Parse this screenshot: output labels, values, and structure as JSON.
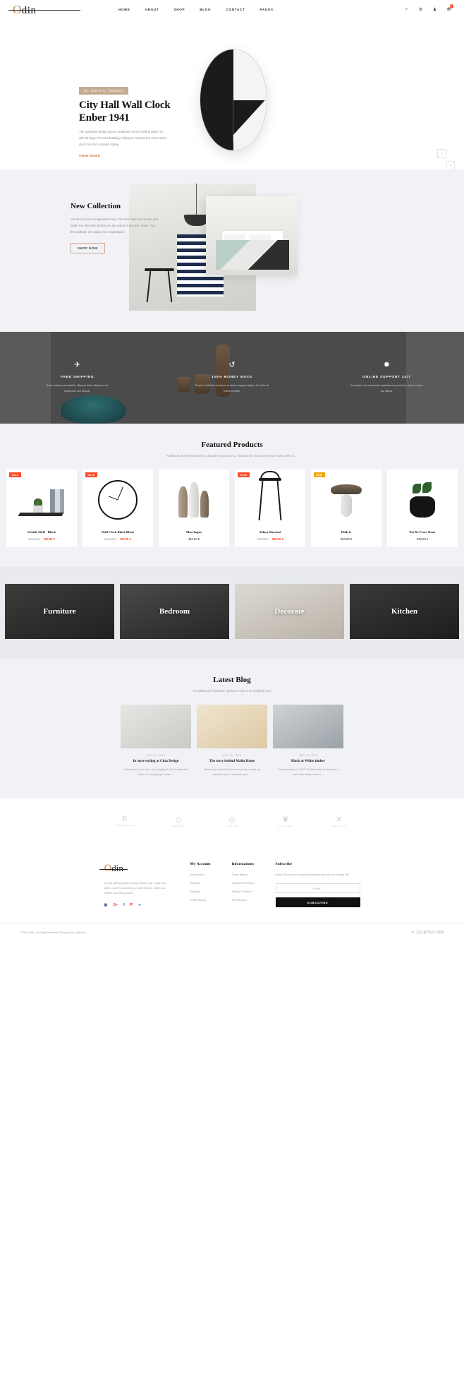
{
  "header": {
    "logo": "Odin",
    "nav": [
      "HOME",
      "ABOUT",
      "SHOP",
      "BLOG",
      "CONTACT",
      "PAGES"
    ],
    "icons": [
      {
        "name": "search-icon",
        "glyph": "⌕"
      },
      {
        "name": "settings-icon",
        "glyph": "⚙"
      },
      {
        "name": "user-icon",
        "glyph": "♟"
      },
      {
        "name": "cart-icon",
        "glyph": "⛃"
      }
    ],
    "cart_count": "0"
  },
  "hero": {
    "byline": "By:  Henrik S. Thomsen",
    "title_line1": "City Hall Wall Clock",
    "title_line2": "Enber 1941",
    "description": "The graphical design places emphasis on the striking black rim, with its large font and detailing helping to contrast the clean white clock face for a classic styling.",
    "cta": "VIEW MORE",
    "prev_arrow": "‹",
    "next_arrow": "›"
  },
  "new_collection": {
    "title": "New Collection",
    "body": "You who set your imaginations free. You who make and create and build. You who take all that you are and let it become, home. You the unafraid, the unique, the inspirational.",
    "button": "SHOP NOW"
  },
  "features": [
    {
      "icon": "airplane-icon",
      "glyph": "✈",
      "title": "FREE SHIPPING",
      "desc": "Quis nostrud exercitation ullamco labor aliquip ex ea commodo con sequat."
    },
    {
      "icon": "refresh-icon",
      "glyph": "↺",
      "title": "100% MONEY BACK",
      "desc": "Empor incididunt ut labore et dolore magna aliqua. Ut enim ad minim veniam."
    },
    {
      "icon": "lifebuoy-icon",
      "glyph": "✹",
      "title": "ONLINE SUPPORT 24/7",
      "desc": "Excepteur sint occaecat cupidatat non proident, sunt in culpa qui officia."
    }
  ],
  "featured": {
    "title": "Featured Products",
    "subtitle": "Nullam sit amet elementum ex, aliquam euismod arcu. Vivamus nisl erat vitae metus ornare amet in ...",
    "products": [
      {
        "name": "Stealth Shelf - Black",
        "old_price": "120.00 €",
        "price": "100.00 €",
        "tag": "SALE",
        "tag_type": "sale",
        "art": "shelf"
      },
      {
        "name": "Wall Clock Black Black",
        "old_price": "150.00 €",
        "price": "130.00 €",
        "tag": "SALE",
        "tag_type": "sale",
        "art": "clock"
      },
      {
        "name": "Marchagne",
        "old_price": "",
        "price": "440.00 €",
        "tag": "",
        "tag_type": "",
        "art": "vase"
      },
      {
        "name": "Sidney Barstool",
        "old_price": "700.00 €",
        "price": "550.00 €",
        "tag": "SALE",
        "tag_type": "sale",
        "art": "stool"
      },
      {
        "name": "HollyG",
        "old_price": "",
        "price": "320.00 €",
        "tag": "NEW",
        "tag_type": "new",
        "art": "lamp"
      },
      {
        "name": "Pot De Feurs Doux",
        "old_price": "",
        "price": "240.00 €",
        "tag": "",
        "tag_type": "",
        "art": "pot"
      }
    ]
  },
  "categories": [
    {
      "label": "Furniture"
    },
    {
      "label": "Bedroom"
    },
    {
      "label": "Decorate"
    },
    {
      "label": "Kitchen"
    }
  ],
  "blog": {
    "title": "Latest Blog",
    "subtitle": "For additional information, please e-mail us at info@odin.com",
    "posts": [
      {
        "date": "DEC 04, 2018",
        "title": "In store styling at Citta Design",
        "excerpt": "Following on from my in store styling at Citta Design last week, I'm now going to share ..."
      },
      {
        "date": "DEC 04, 2018",
        "title": "The story behind Malfu Home",
        "excerpt": "Melbourne based Malfu Home recently caught my attention when I stumbled upon ..."
      },
      {
        "date": "DEC 04, 2018",
        "title": "Black or White timber",
        "excerpt": "Since its launch in 2016 The Minimalist has become a well loved design store in ..."
      }
    ]
  },
  "brands": [
    {
      "mark": "R",
      "caption": "DOOR PALACE"
    },
    {
      "mark": "◇",
      "caption": "DIAMOND"
    },
    {
      "mark": "◎",
      "caption": "VINTAGE"
    },
    {
      "mark": "❦",
      "caption": "Ambassador"
    },
    {
      "mark": "✕",
      "caption": "CROSS CO"
    }
  ],
  "footer": {
    "logo": "Odin",
    "about": "I'm just getting started. Every chance I get, I water the plants. Lion! To succeed you must believe. When you believe, you will succeed.",
    "socials": [
      {
        "name": "instagram-icon",
        "glyph": "▣",
        "color": "#3b5998"
      },
      {
        "name": "google-plus-icon",
        "glyph": "G+",
        "color": "#dd4b39"
      },
      {
        "name": "facebook-icon",
        "glyph": "f",
        "color": "#3b5998"
      },
      {
        "name": "pinterest-icon",
        "glyph": "P",
        "color": "#e60023"
      },
      {
        "name": "twitter-icon",
        "glyph": "➤",
        "color": "#1da1f2"
      }
    ],
    "account": {
      "heading": "My Account",
      "links": [
        "My Account",
        "Wishlist",
        "Specials",
        "Order History"
      ]
    },
    "informations": {
      "heading": "Informations",
      "links": [
        "Order Status",
        "Payment & Pricinh",
        "Return & Refund",
        "Gift Voucher"
      ]
    },
    "subscribe": {
      "heading": "Subscribe",
      "text": "Enjoy 15% off your next purchase when you join our mailing list!",
      "placeholder": "E-mail...",
      "button": "SUBSCRIBE"
    },
    "copyright": "© 2018 Odin - All Rights Reserved. Designed by Lactheme.",
    "watermark": "企业官网设计模板"
  },
  "colors": {
    "accent": "#d4622a",
    "sale": "#ff4a23",
    "tan": "#c4ab93",
    "dark": "#4b4b4b",
    "light_bg": "#f1f2f5"
  }
}
